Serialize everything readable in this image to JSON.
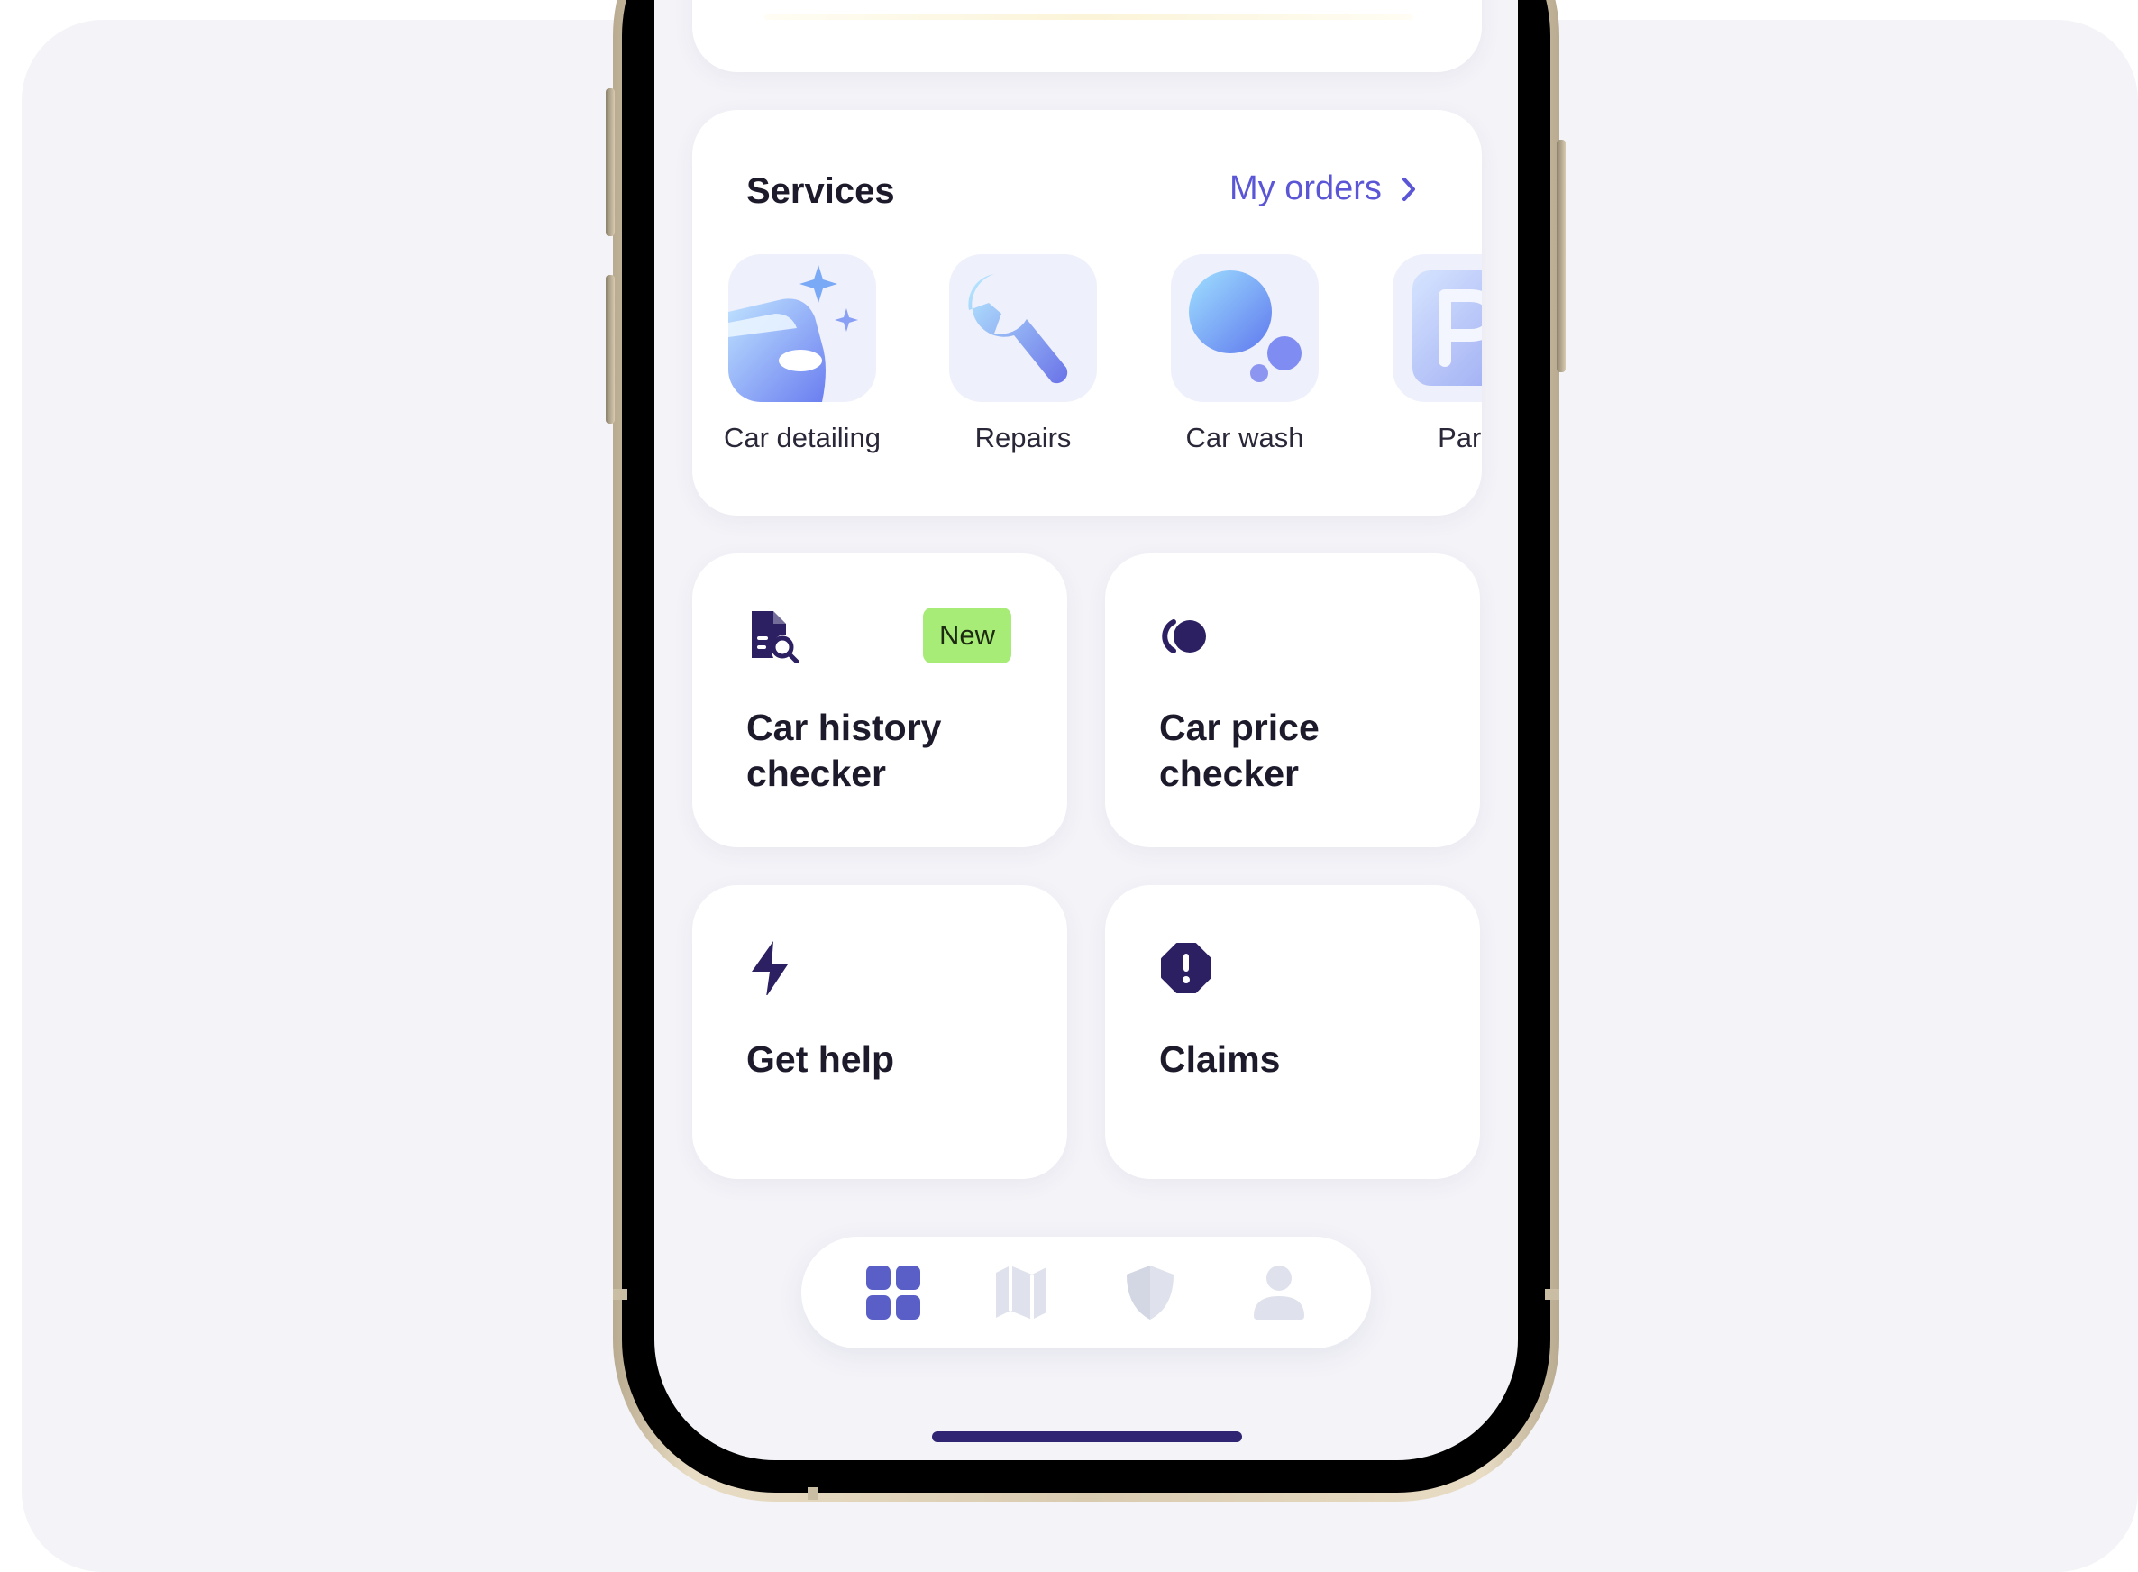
{
  "services": {
    "title": "Services",
    "my_orders_label": "My orders",
    "items": [
      {
        "label": "Car detailing",
        "icon": "car-detailing-icon"
      },
      {
        "label": "Repairs",
        "icon": "wrench-icon"
      },
      {
        "label": "Car wash",
        "icon": "car-wash-bubbles-icon"
      },
      {
        "label": "Park",
        "icon": "parking-icon"
      }
    ]
  },
  "features": [
    {
      "label": "Car history checker",
      "icon": "document-search-icon",
      "badge": "New"
    },
    {
      "label": "Car price checker",
      "icon": "coin-icon"
    },
    {
      "label": "Get help",
      "icon": "lightning-icon"
    },
    {
      "label": "Claims",
      "icon": "alert-octagon-icon"
    }
  ],
  "bottom_nav": [
    {
      "icon": "grid-icon",
      "active": true
    },
    {
      "icon": "map-icon",
      "active": false
    },
    {
      "icon": "shield-icon",
      "active": false
    },
    {
      "icon": "user-icon",
      "active": false
    }
  ],
  "colors": {
    "accent": "#5a56d6",
    "icon_dark": "#2c2063",
    "badge_bg": "#a8ec78",
    "nav_active": "#5a5fc8",
    "nav_inactive": "#dfe2ec",
    "background": "#f3f3f8",
    "phone_gold": "#d8cbb0"
  }
}
